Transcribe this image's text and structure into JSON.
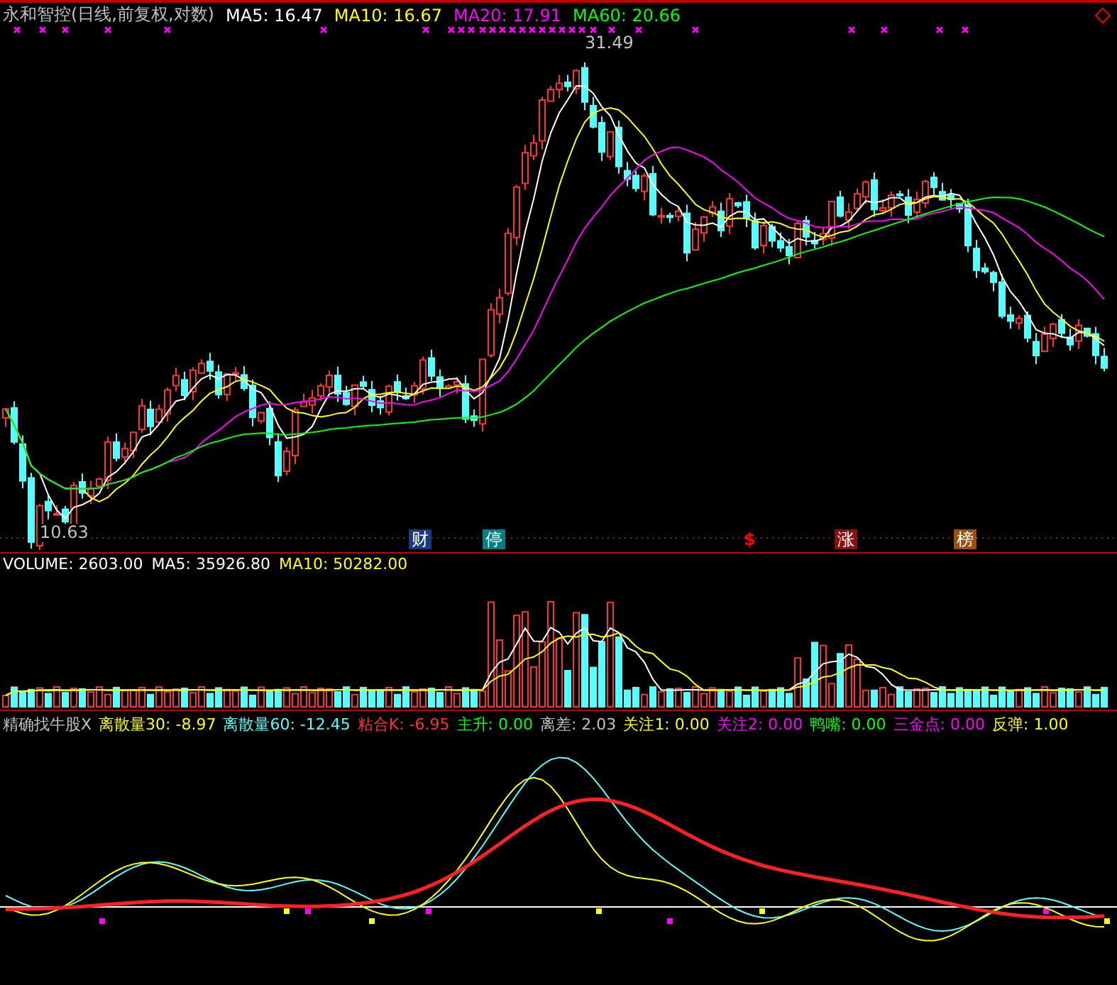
{
  "price_panel": {
    "title": "永和智控(日线,前复权,对数)",
    "indicators": [
      {
        "label": "MA5: 16.47",
        "color": "#ffffff"
      },
      {
        "label": "MA10: 16.67",
        "color": "#ffff00"
      },
      {
        "label": "MA20: 17.91",
        "color": "#ff00ff"
      },
      {
        "label": "MA60: 20.66",
        "color": "#00ff00"
      }
    ],
    "high_label": "31.49",
    "low_label": "10.63",
    "event_tags": [
      {
        "text": "财",
        "kind": "badge",
        "color": "#1a3a80"
      },
      {
        "text": "停",
        "kind": "badge",
        "color": "#008080"
      },
      {
        "text": "$",
        "kind": "mark",
        "color": "#ff0000"
      },
      {
        "text": "涨",
        "kind": "badge",
        "color": "#8b1010"
      },
      {
        "text": "榜",
        "kind": "badge",
        "color": "#9a5010"
      }
    ]
  },
  "volume_panel": {
    "indicators": [
      {
        "label": "VOLUME: 2603.00",
        "color": "#ffffff"
      },
      {
        "label": "MA5: 35926.80",
        "color": "#ffffff"
      },
      {
        "label": "MA10: 50282.00",
        "color": "#ffff00"
      }
    ]
  },
  "indicator_panel": {
    "name": "精确找牛股X",
    "indicators": [
      {
        "label": "离散量30: -8.97",
        "color": "#ffff00"
      },
      {
        "label": "离散量60: -12.45",
        "color": "#54ffff"
      },
      {
        "label": "粘合K: -6.95",
        "color": "#ff3030"
      },
      {
        "label": "主升: 0.00",
        "color": "#00ff00"
      },
      {
        "label": "离差: 2.03",
        "color": "#c0c0c0"
      },
      {
        "label": "关注1: 0.00",
        "color": "#ffff00"
      },
      {
        "label": "关注2: 0.00",
        "color": "#ff00ff"
      },
      {
        "label": "鸭嘴: 0.00",
        "color": "#00ff00"
      },
      {
        "label": "三金点: 0.00",
        "color": "#ff00ff"
      },
      {
        "label": "反弹: 1.00",
        "color": "#ffff00"
      }
    ]
  }
}
